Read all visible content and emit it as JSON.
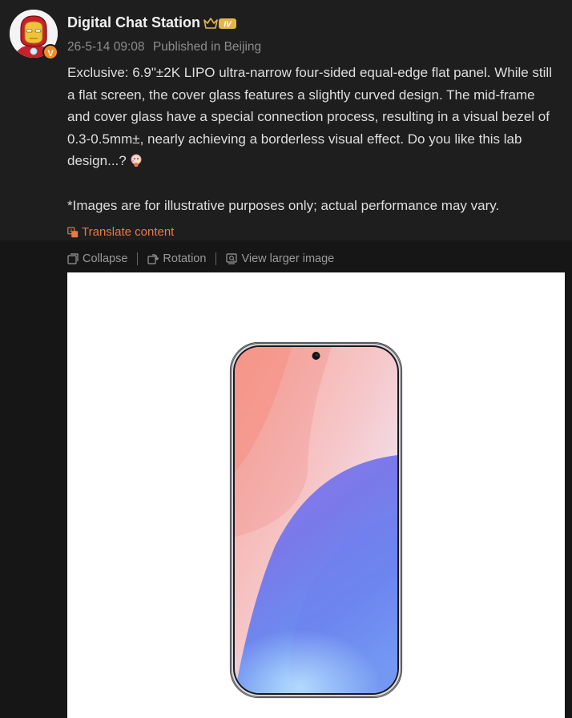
{
  "post": {
    "username": "Digital Chat Station",
    "level_badge": "IV",
    "verified_badge": "V",
    "date": "26-5-14 09:08",
    "location": "Published in Beijing",
    "text": "Exclusive: 6.9\"±2K LIPO ultra-narrow four-sided equal-edge flat panel. While still a flat screen, the cover glass features a slightly curved design. The mid-frame and cover glass have a special connection process, resulting in a visual bezel of 0.3-0.5mm±, nearly achieving a borderless visual effect. Do you like this lab design...?",
    "disclaimer": "*Images are for illustrative purposes only; actual performance may vary.",
    "translate_label": "Translate content"
  },
  "image_actions": {
    "collapse": "Collapse",
    "rotation": "Rotation",
    "view_larger": "View larger image"
  },
  "icons": {
    "avatar": "iron-man-avatar",
    "crown": "crown-icon",
    "emoji": "thinking-emoji-icon",
    "translate": "translate-icon",
    "collapse": "collapse-icon",
    "rotation": "rotate-icon",
    "view_larger": "zoom-image-icon"
  },
  "colors": {
    "background": "#161616",
    "accent_orange": "#e8794a",
    "meta_gray": "#8d8d8d",
    "badge_gold": "#e6b54a"
  }
}
